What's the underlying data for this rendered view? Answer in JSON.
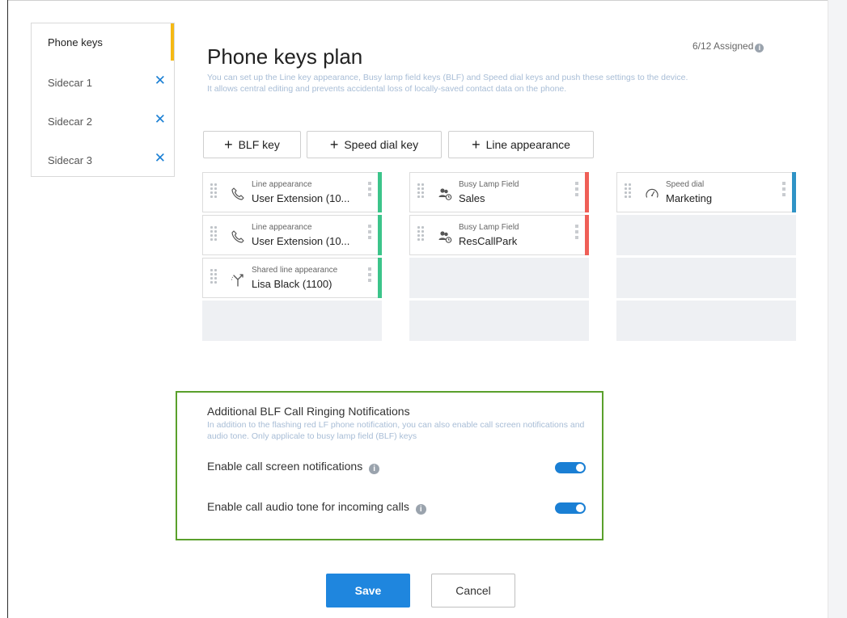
{
  "tabs": [
    {
      "label": "Phone keys",
      "active": true,
      "removable": false
    },
    {
      "label": "Sidecar 1",
      "active": false,
      "removable": true
    },
    {
      "label": "Sidecar 2",
      "active": false,
      "removable": true
    },
    {
      "label": "Sidecar 3",
      "active": false,
      "removable": true
    }
  ],
  "tab_close_glyph": "✕",
  "header": {
    "title": "Phone keys plan",
    "assigned": "6/12 Assigned",
    "description": "You can set up the Line key appearance, Busy lamp field keys (BLF) and Speed dial keys and push these settings to the device. It allows central editing and prevents accidental loss of locally-saved contact data on the phone."
  },
  "add_buttons": {
    "blf": "BLF key",
    "speed_dial": "Speed dial key",
    "line_appearance": "Line appearance"
  },
  "key_columns": [
    {
      "keys": [
        {
          "type": "Line appearance",
          "name": "User Extension (10...",
          "icon": "phone-icon",
          "color": "#3cc48a"
        },
        {
          "type": "Line appearance",
          "name": "User Extension (10...",
          "icon": "phone-icon",
          "color": "#3cc48a"
        },
        {
          "type": "Shared line appearance",
          "name": "Lisa Black (1100)",
          "icon": "shared-line-icon",
          "color": "#3cc48a"
        }
      ]
    },
    {
      "keys": [
        {
          "type": "Busy Lamp Field",
          "name": "Sales",
          "icon": "blf-users-icon",
          "color": "#ef5f57"
        },
        {
          "type": "Busy Lamp Field",
          "name": "ResCallPark",
          "icon": "blf-users-icon",
          "color": "#ef5f57"
        }
      ]
    },
    {
      "keys": [
        {
          "type": "Speed dial",
          "name": "Marketing",
          "icon": "speed-dial-icon",
          "color": "#2f93c6"
        }
      ]
    }
  ],
  "notifications": {
    "title": "Additional BLF Call Ringing Notifications",
    "description": "In addition to the flashing red LF phone notification, you can also enable call screen notifications and audio tone. Only applicale to busy lamp field (BLF) keys",
    "screen_label": "Enable call screen notifications",
    "screen_enabled": true,
    "audio_label": "Enable call audio tone for incoming calls",
    "audio_enabled": true
  },
  "footer": {
    "save": "Save",
    "cancel": "Cancel"
  },
  "colors": {
    "accent": "#1f86de",
    "active_tab": "#f5b914",
    "highlight_border": "#5aa02c",
    "line_key": "#3cc48a",
    "blf_key": "#ef5f57",
    "speed_key": "#2f93c6"
  }
}
